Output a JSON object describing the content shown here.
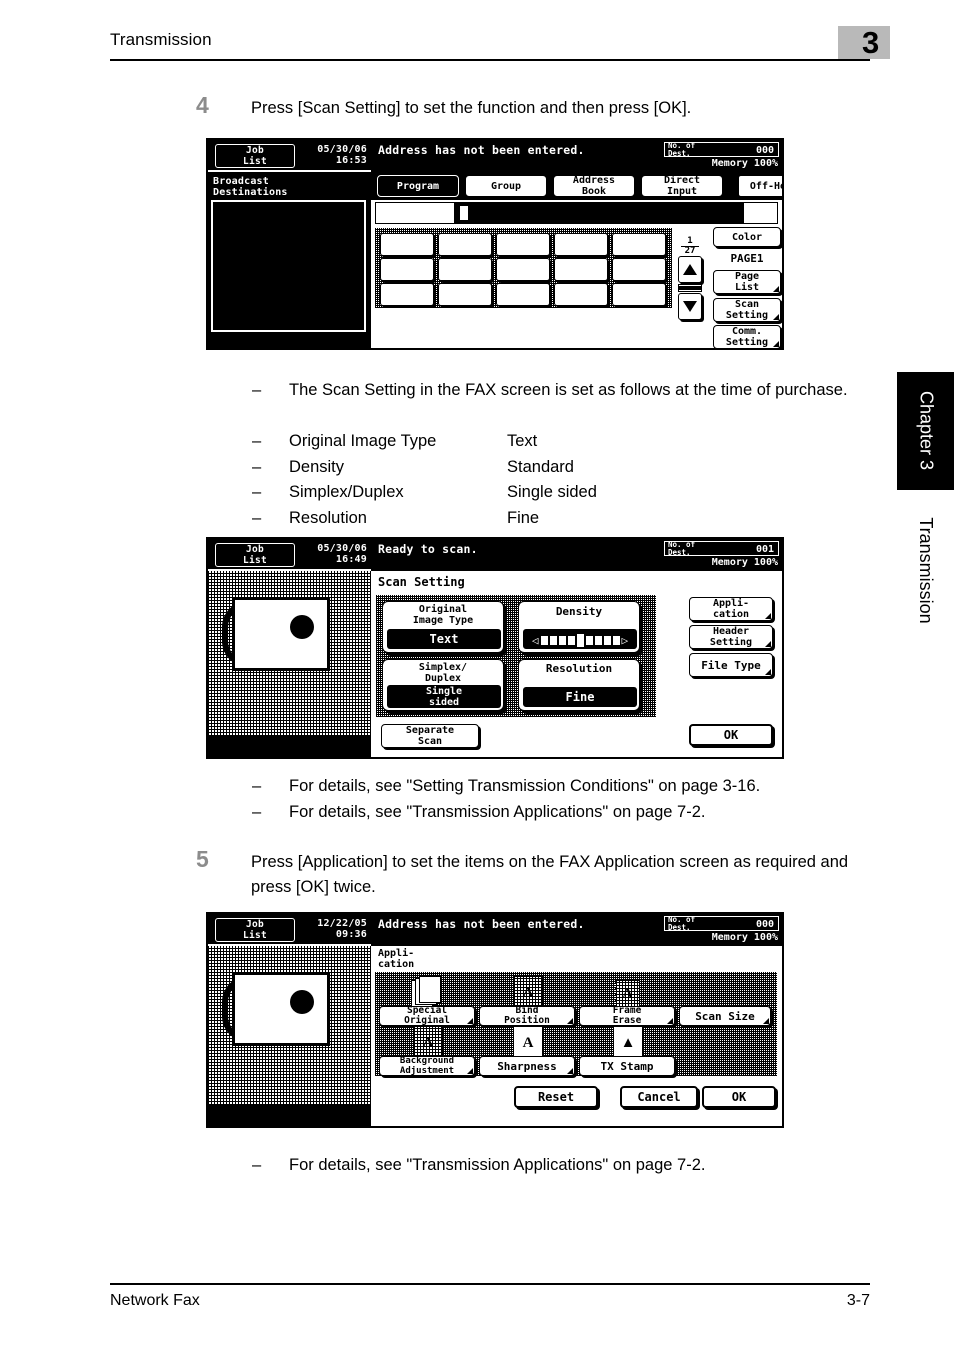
{
  "header": {
    "title": "Transmission",
    "chapter_number": "3"
  },
  "side_tabs": {
    "chapter": "Chapter 3",
    "section": "Transmission"
  },
  "footer": {
    "left": "Network Fax",
    "right": "3-7"
  },
  "steps": [
    {
      "number": "4",
      "text": "Press [Scan Setting] to set the function and then press [OK]."
    },
    {
      "number": "5",
      "text": "Press [Application] to set the items on the FAX Application screen as required and press [OK] twice."
    }
  ],
  "bullets_scan_defaults": {
    "dash": "–",
    "intro": "The Scan Setting in the FAX screen is set as follows at the time of purchase.",
    "rows": [
      {
        "label": "Original Image Type",
        "value": "Text"
      },
      {
        "label": "Density",
        "value": "Standard"
      },
      {
        "label": "Simplex/Duplex",
        "value": "Single sided"
      },
      {
        "label": "Resolution",
        "value": "Fine"
      }
    ]
  },
  "bullets_refs_1": [
    "For details, see \"Setting Transmission Conditions\" on page 3-16.",
    "For details, see \"Transmission Applications\" on page 7-2."
  ],
  "bullets_refs_2": [
    "For details, see \"Transmission Applications\" on page 7-2."
  ],
  "panel1": {
    "job_list_label_1": "Job",
    "job_list_label_2": "List",
    "date": "05/30/06",
    "time": "16:53",
    "status_message": "Address has not been entered.",
    "dest_label_1": "No. of",
    "dest_label_2": "Dest.",
    "dest_value": "000",
    "memory": "Memory 100%",
    "left_label_1": "Broadcast",
    "left_label_2": "Destinations",
    "tabs": [
      {
        "label": "Program",
        "selected": true
      },
      {
        "label": "Group",
        "selected": false
      },
      {
        "label_1": "Address",
        "label_2": "Book",
        "selected": false
      },
      {
        "label_1": "Direct",
        "label_2": "Input",
        "selected": false
      }
    ],
    "off_hook": "Off-Hook",
    "color_button": "Color",
    "page_indicator": "PAGE1",
    "page_list_1": "Page",
    "page_list_2": "List",
    "scan_setting_1": "Scan",
    "scan_setting_2": "Setting",
    "comm_setting_1": "Comm.",
    "comm_setting_2": "Setting",
    "page_counter_num": "1",
    "page_counter_den": "27"
  },
  "panel2": {
    "job_list_label_1": "Job",
    "job_list_label_2": "List",
    "date": "05/30/06",
    "time": "16:49",
    "status_message": "Ready to scan.",
    "dest_label_1": "No. of",
    "dest_label_2": "Dest.",
    "dest_value": "001",
    "memory": "Memory 100%",
    "screen_title": "Scan Setting",
    "settings": [
      {
        "title_1": "Original",
        "title_2": "Image Type",
        "value": "Text"
      },
      {
        "title_1": "Density",
        "title_2": "",
        "value": ""
      },
      {
        "title_1": "Simplex/",
        "title_2": "Duplex",
        "value_1": "Single",
        "value_2": "sided"
      },
      {
        "title_1": "Resolution",
        "title_2": "",
        "value": "Fine"
      }
    ],
    "side_buttons": [
      {
        "label_1": "Appli-",
        "label_2": "cation"
      },
      {
        "label_1": "Header",
        "label_2": "Setting"
      },
      {
        "label_1": "File Type",
        "label_2": ""
      }
    ],
    "separate_scan_1": "Separate",
    "separate_scan_2": "Scan",
    "ok_button": "OK"
  },
  "panel3": {
    "job_list_label_1": "Job",
    "job_list_label_2": "List",
    "date": "12/22/05",
    "time": "09:36",
    "status_message": "Address has not been entered.",
    "dest_label_1": "No. of",
    "dest_label_2": "Dest.",
    "dest_value": "000",
    "memory": "Memory 100%",
    "screen_title_1": "Appli-",
    "screen_title_2": "cation",
    "apps_row1": [
      {
        "label_1": "Special",
        "label_2": "Original",
        "icon": "document-stack-icon"
      },
      {
        "label_1": "Bind",
        "label_2": "Position",
        "icon": "bind-position-icon"
      },
      {
        "label_1": "Frame",
        "label_2": "Erase",
        "icon": "frame-erase-icon"
      },
      {
        "label_1": "Scan Size",
        "label_2": "",
        "icon": "scan-size-icon"
      }
    ],
    "apps_row2": [
      {
        "label_1": "Background",
        "label_2": "Adjustment",
        "icon": "background-adjustment-icon"
      },
      {
        "label_1": "Sharpness",
        "label_2": "",
        "icon": "sharpness-icon"
      },
      {
        "label_1": "TX Stamp",
        "label_2": "",
        "icon": "tx-stamp-icon"
      }
    ],
    "reset_button": "Reset",
    "cancel_button": "Cancel",
    "ok_button": "OK"
  },
  "colors": {
    "chapter_box": "#b9b9b9",
    "step_number": "#8c8c8c",
    "ink": "#000000",
    "paper": "#ffffff"
  }
}
